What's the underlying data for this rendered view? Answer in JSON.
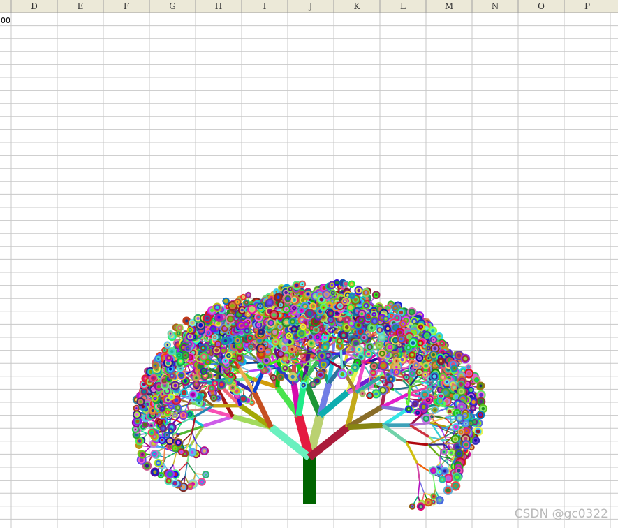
{
  "sheet": {
    "columns": [
      "D",
      "E",
      "F",
      "G",
      "H",
      "I",
      "J",
      "K",
      "L",
      "M",
      "N",
      "O",
      "P"
    ],
    "cell_text": "00",
    "colors": {
      "grid": "#c8c8c8",
      "header_bg": "#ece9d8",
      "header_line": "#a0a0a0",
      "header_text": "#333333"
    }
  },
  "drawing": {
    "trunk_color": "#006400"
  },
  "watermark": "CSDN @gc0322"
}
